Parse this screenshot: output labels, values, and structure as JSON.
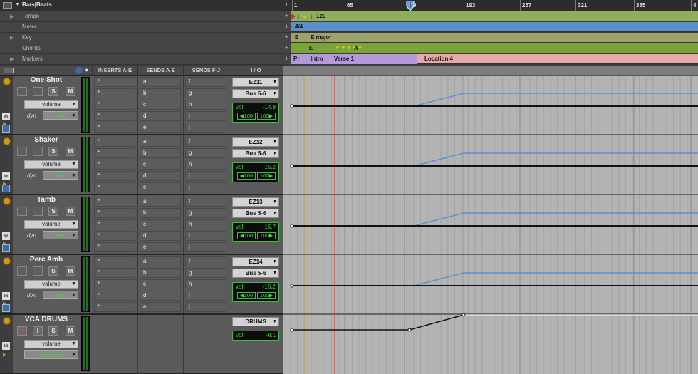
{
  "rulers": {
    "bars_beats_label": "Bars|Beats",
    "rows": [
      "Tempo",
      "Meter",
      "Key",
      "Chords",
      "Markers"
    ],
    "bar_numbers": [
      "1",
      "65",
      "129",
      "193",
      "257",
      "321",
      "385",
      "4"
    ],
    "tempo_value": "120",
    "meter_value": "4/4",
    "key_values": [
      "E",
      "E major"
    ],
    "chord_values": [
      "E",
      "A"
    ],
    "markers": [
      "Pr",
      "Intro",
      "Verse 1",
      "Location 4"
    ]
  },
  "columns": {
    "inserts": "INSERTS A-E",
    "sends_ae": "SENDS A-E",
    "sends_fj": "SENDS F-J",
    "io": "I / O"
  },
  "tracks": [
    {
      "name": "One Shot",
      "view": "volume",
      "mode": "read",
      "dyn": "dyn",
      "inserts": [
        "*",
        "*",
        "*",
        "*",
        "*"
      ],
      "sends_ae": [
        "a",
        "b",
        "c",
        "d",
        "e"
      ],
      "sends_fj": [
        "f",
        "g",
        "h",
        "i",
        "j"
      ],
      "input": "EZ11",
      "output": "Bus 5-6",
      "vol_label": "vol",
      "vol": "-14.9",
      "pan_l": "◀100",
      "pan_r": "100▶"
    },
    {
      "name": "Shaker",
      "view": "volume",
      "mode": "read",
      "dyn": "dyn",
      "inserts": [
        "*",
        "*",
        "*",
        "*",
        "*"
      ],
      "sends_ae": [
        "a",
        "b",
        "c",
        "d",
        "e"
      ],
      "sends_fj": [
        "f",
        "g",
        "h",
        "i",
        "j"
      ],
      "input": "EZ12",
      "output": "Bus 5-6",
      "vol_label": "vol",
      "vol": "-15.2",
      "pan_l": "◀100",
      "pan_r": "100▶"
    },
    {
      "name": "Tamb",
      "view": "volume",
      "mode": "read",
      "dyn": "dyn",
      "inserts": [
        "*",
        "*",
        "*",
        "*",
        "*"
      ],
      "sends_ae": [
        "a",
        "b",
        "c",
        "d",
        "e"
      ],
      "sends_fj": [
        "f",
        "g",
        "h",
        "i",
        "j"
      ],
      "input": "EZ13",
      "output": "Bus 5-6",
      "vol_label": "vol",
      "vol": "-15.7",
      "pan_l": "◀100",
      "pan_r": "100▶"
    },
    {
      "name": "Perc Amb",
      "view": "volume",
      "mode": "read",
      "dyn": "dyn",
      "inserts": [
        "*",
        "*",
        "*",
        "*",
        "*"
      ],
      "sends_ae": [
        "a",
        "b",
        "c",
        "d",
        "e"
      ],
      "sends_fj": [
        "f",
        "g",
        "h",
        "i",
        "j"
      ],
      "input": "EZ14",
      "output": "Bus 5-6",
      "vol_label": "vol",
      "vol": "-15.2",
      "pan_l": "◀100",
      "pan_r": "100▶"
    }
  ],
  "vca": {
    "name": "VCA DRUMS",
    "view": "volume",
    "mode": "auto read",
    "output": "DRUMS",
    "vol_label": "vol",
    "vol": "-0.1"
  },
  "buttons": {
    "solo": "S",
    "mute": "M",
    "rec": "●",
    "input": "I"
  },
  "colors": {
    "tempo": "#8fae5c",
    "meter": "#5d8fc9",
    "key": "#9ba36a",
    "chords": "#7aa43a",
    "markers_a": "#b49ad8",
    "markers_b": "#e8a8a8",
    "automation_blue": "#5b8fd6",
    "playhead": "#e03030",
    "track_handle": "#c79a1b"
  }
}
